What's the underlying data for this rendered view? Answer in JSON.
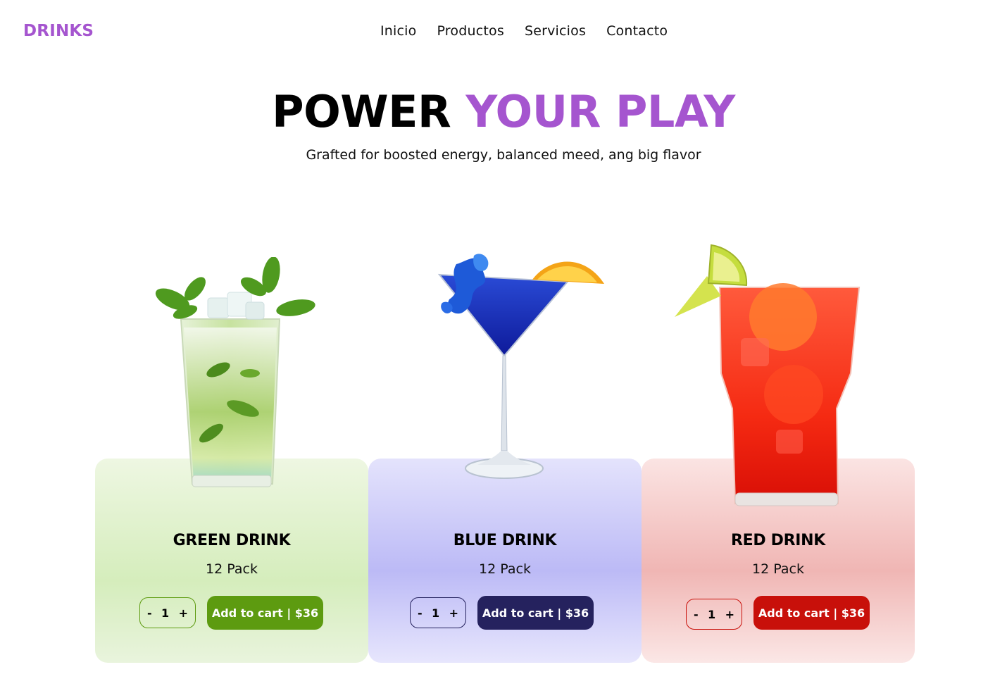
{
  "brand": "DRINKS",
  "nav": {
    "items": [
      "Inicio",
      "Productos",
      "Servicios",
      "Contacto"
    ]
  },
  "hero": {
    "title_part1": "POWER",
    "title_part2": "YOUR PLAY",
    "subtitle": "Grafted for boosted energy, balanced meed, ang big flavor"
  },
  "colors": {
    "brand": "#a555cf",
    "green": "#5d9b10",
    "blue": "#25225e",
    "red": "#c8100a"
  },
  "products": [
    {
      "name": "GREEN DRINK",
      "pack": "12 Pack",
      "qty": "1",
      "minus": "-",
      "plus": "+",
      "cart": "Add to cart | $36",
      "image": "mojito-glass-image"
    },
    {
      "name": "BLUE DRINK",
      "pack": "12 Pack",
      "qty": "1",
      "minus": "-",
      "plus": "+",
      "cart": "Add to cart | $36",
      "image": "martini-glass-image"
    },
    {
      "name": "RED DRINK",
      "pack": "12 Pack",
      "qty": "1",
      "minus": "-",
      "plus": "+",
      "cart": "Add to cart | $36",
      "image": "highball-glass-image"
    }
  ]
}
